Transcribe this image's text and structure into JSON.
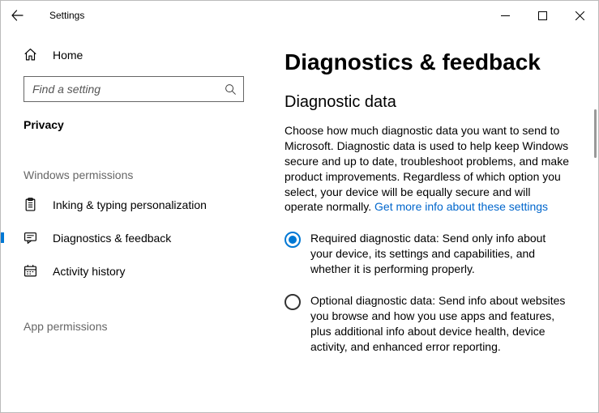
{
  "window": {
    "title": "Settings"
  },
  "sidebar": {
    "home_label": "Home",
    "search_placeholder": "Find a setting",
    "category_label": "Privacy",
    "section_windows_label": "Windows permissions",
    "section_app_label": "App permissions",
    "items": [
      {
        "label": "Inking & typing personalization",
        "selected": false
      },
      {
        "label": "Diagnostics & feedback",
        "selected": true
      },
      {
        "label": "Activity history",
        "selected": false
      }
    ]
  },
  "content": {
    "page_title": "Diagnostics & feedback",
    "section_heading": "Diagnostic data",
    "intro_text": "Choose how much diagnostic data you want to send to Microsoft. Diagnostic data is used to help keep Windows secure and up to date, troubleshoot problems, and make product improvements. Regardless of which option you select, your device will be equally secure and will operate normally. ",
    "intro_link": "Get more info about these settings",
    "options": [
      {
        "checked": true,
        "text": "Required diagnostic data: Send only info about your device, its settings and capabilities, and whether it is performing properly."
      },
      {
        "checked": false,
        "text": "Optional diagnostic data: Send info about websites you browse and how you use apps and features, plus additional info about device health, device activity, and enhanced error reporting."
      }
    ]
  }
}
